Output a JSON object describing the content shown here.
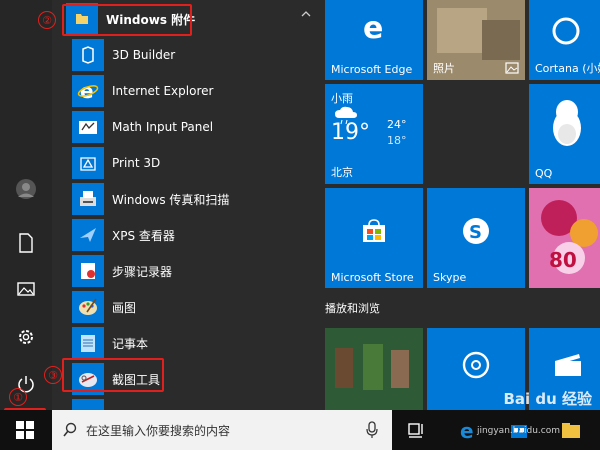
{
  "annotations": {
    "badge1": "①",
    "badge2": "②",
    "badge3": "③"
  },
  "app_list": {
    "group_label": "Windows 附件",
    "items": [
      {
        "label": "3D Builder"
      },
      {
        "label": "Internet Explorer"
      },
      {
        "label": "Math Input Panel"
      },
      {
        "label": "Print 3D"
      },
      {
        "label": "Windows 传真和扫描"
      },
      {
        "label": "XPS 查看器"
      },
      {
        "label": "步骤记录器"
      },
      {
        "label": "画图"
      },
      {
        "label": "记事本"
      },
      {
        "label": "截图工具"
      }
    ]
  },
  "tiles": {
    "edge": "Microsoft Edge",
    "photos": "照片",
    "cortana": "Cortana (小娜)",
    "weather": {
      "condition": "小雨",
      "temp": "19°",
      "high": "24°",
      "low": "18°",
      "city": "北京"
    },
    "qq": "QQ",
    "store": "Microsoft Store",
    "skype": "Skype",
    "candy_number": "80",
    "section_play": "播放和浏览"
  },
  "taskbar": {
    "search_placeholder": "在这里输入你要搜索的内容"
  },
  "watermark": {
    "brand": "Bai du 经验",
    "url": "jingyan.baidu.com"
  },
  "colors": {
    "accent": "#0078d7",
    "annotation": "#e0201c",
    "taskbar": "#101010"
  }
}
